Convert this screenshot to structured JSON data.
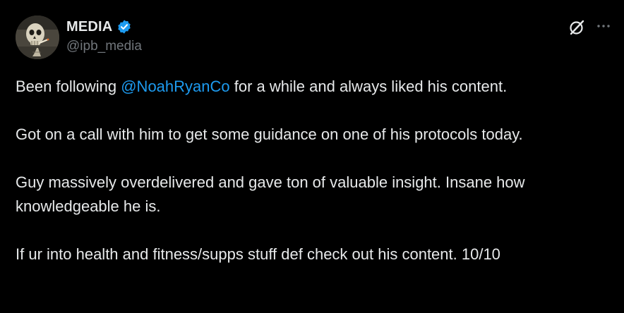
{
  "author": {
    "display_name": "MEDIA",
    "handle": "@ipb_media",
    "verified": true,
    "avatar": "smoking-skeleton-painting"
  },
  "actions": {
    "grok_icon": "grok-icon",
    "more_icon": "more-icon"
  },
  "tweet": {
    "p1_before": "Been following ",
    "p1_mention": "@NoahRyanCo",
    "p1_after": " for a while and always liked his content.",
    "p2": "Got on a call with him to get some guidance on one of his protocols today.",
    "p3": "Guy massively overdelivered and gave ton of valuable insight. Insane how knowledgeable he is.",
    "p4": "If ur into health and fitness/supps stuff def check out his content. 10/10"
  },
  "colors": {
    "background": "#000000",
    "text": "#e7e9ea",
    "muted": "#71767b",
    "accent": "#1d9bf0"
  }
}
